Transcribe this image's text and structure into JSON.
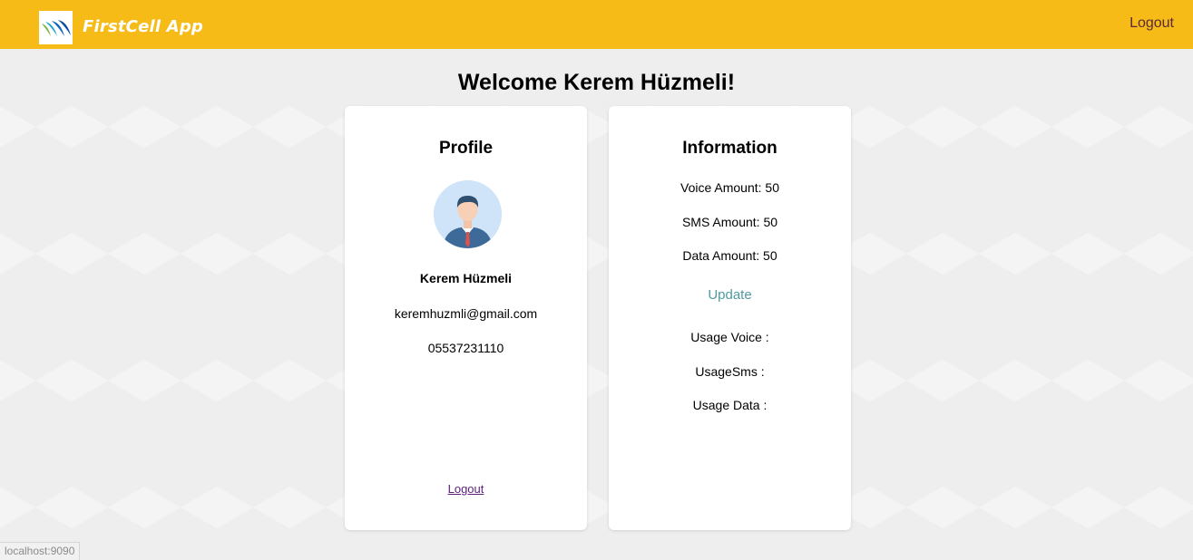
{
  "header": {
    "brand": "FirstCell App",
    "logout_label": "Logout"
  },
  "welcome": "Welcome Kerem Hüzmeli!",
  "profile": {
    "title": "Profile",
    "name": "Kerem Hüzmeli",
    "email": "keremhuzmli@gmail.com",
    "phone": "05537231110",
    "logout_label": "Logout"
  },
  "information": {
    "title": "Information",
    "voice_amount": "Voice Amount: 50",
    "sms_amount": "SMS Amount: 50",
    "data_amount": "Data Amount: 50",
    "update_label": "Update",
    "usage_voice": "Usage Voice :",
    "usage_sms": "UsageSms :",
    "usage_data": "Usage Data :"
  },
  "status_bar": {
    "url": "localhost:9090"
  },
  "colors": {
    "navbar": "#f6bb17",
    "link_update": "#4f9b9f",
    "link_logout": "#5b1f7a"
  }
}
